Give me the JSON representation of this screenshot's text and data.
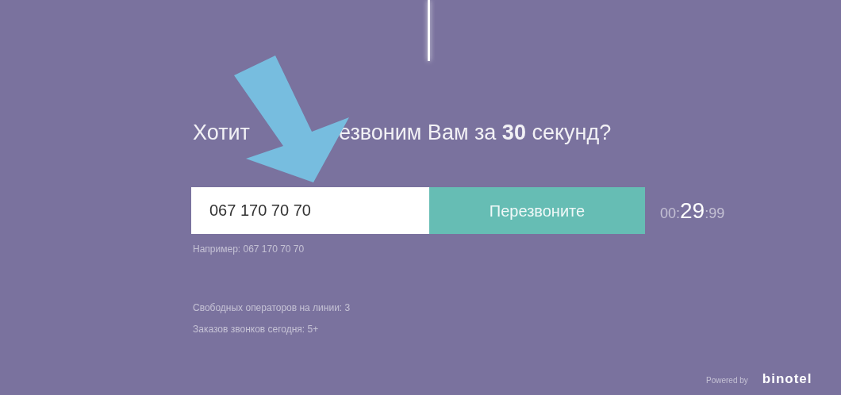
{
  "heading": {
    "visible_parts": [
      "Хотит",
      "езвоним Вам за **30** секунд?"
    ]
  },
  "phone_field": {
    "value": "067 170 70 70"
  },
  "call_button": {
    "label": "Перезвоните"
  },
  "timer": {
    "minutes": "00:",
    "seconds": "29",
    "hundredths": ":99"
  },
  "hint": "Например: 067 170 70 70",
  "stats": [
    "Свободных операторов на линии: 3",
    "Заказов звонков сегодня: 5+"
  ],
  "footer": {
    "powered_by": "Powered by",
    "brand": "binotel"
  }
}
